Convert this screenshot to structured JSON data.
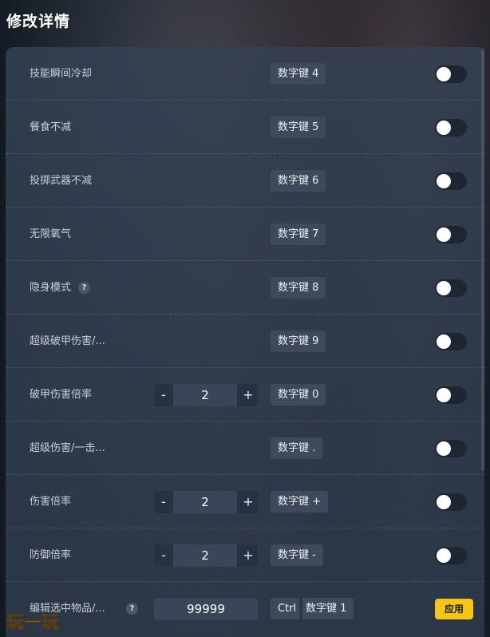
{
  "page_title": "修改详情",
  "rows": [
    {
      "label": "技能瞬间冷却",
      "key": "数字键 4"
    },
    {
      "label": "餐食不减",
      "key": "数字键 5"
    },
    {
      "label": "投掷武器不减",
      "key": "数字键 6"
    },
    {
      "label": "无限氧气",
      "key": "数字键 7"
    },
    {
      "label": "隐身模式",
      "key": "数字键 8",
      "help": "?"
    },
    {
      "label": "超级破甲伤害/...",
      "key": "数字键 9"
    },
    {
      "label": "破甲伤害倍率",
      "key": "数字键 0",
      "value": "2"
    },
    {
      "label": "超级伤害/一击...",
      "key": "数字键 ."
    },
    {
      "label": "伤害倍率",
      "key": "数字键 +",
      "value": "2"
    },
    {
      "label": "防御倍率",
      "key": "数字键 -",
      "value": "2"
    }
  ],
  "edit_row": {
    "label": "编辑选中物品/...",
    "help": "?",
    "value": "99999",
    "key_modifier": "Ctrl",
    "key": "数字键 1",
    "apply_label": "应用"
  },
  "stepper": {
    "minus": "-",
    "plus": "+"
  },
  "toggles_state": "off",
  "watermark": "玩一玩",
  "colors": {
    "accent": "#f5c518",
    "panel": "#344052",
    "key_bg": "#3e4a5c"
  }
}
